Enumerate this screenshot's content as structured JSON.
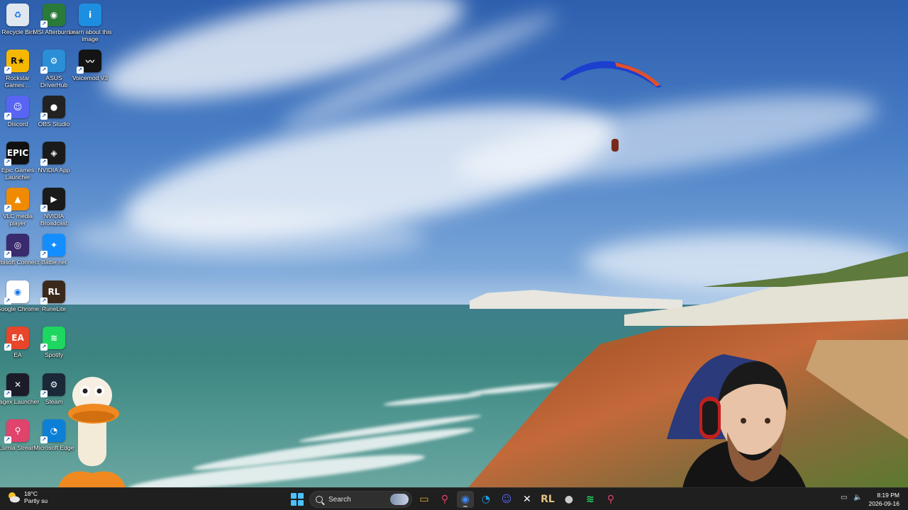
{
  "desktop": {
    "icons": [
      {
        "label": "Recycle Bin",
        "icon": "recycle-bin-icon",
        "color": "#dfe7ef"
      },
      {
        "label": "MSI Afterburner",
        "icon": "msi-afterburner-icon",
        "color": "#2a7a3a"
      },
      {
        "label": "Learn about this image",
        "icon": "info-icon",
        "color": "#1e8fe0"
      },
      {
        "label": "Rockstar Games ...",
        "icon": "rockstar-icon",
        "color": "#f5b800"
      },
      {
        "label": "ASUS DriverHub",
        "icon": "asus-driverhub-icon",
        "color": "#2a8fd6"
      },
      {
        "label": "Voicemod V3",
        "icon": "voicemod-icon",
        "color": "#141414"
      },
      {
        "label": "Discord",
        "icon": "discord-icon",
        "color": "#5865f2"
      },
      {
        "label": "OBS Studio",
        "icon": "obs-icon",
        "color": "#222222"
      },
      {
        "label": "Epic Games Launcher",
        "icon": "epic-games-icon",
        "color": "#111111"
      },
      {
        "label": "NVIDIA App",
        "icon": "nvidia-icon",
        "color": "#1a1a1a"
      },
      {
        "label": "VLC media player",
        "icon": "vlc-icon",
        "color": "#f08a00"
      },
      {
        "label": "NVIDIA Broadcast",
        "icon": "nvidia-broadcast-icon",
        "color": "#1a1a1a"
      },
      {
        "label": "Ubisoft Connect",
        "icon": "ubisoft-icon",
        "color": "#3a2a6e"
      },
      {
        "label": "Battle.net",
        "icon": "battlenet-icon",
        "color": "#148eff"
      },
      {
        "label": "Google Chrome",
        "icon": "chrome-icon",
        "color": "#ffffff"
      },
      {
        "label": "RuneLite",
        "icon": "runelite-icon",
        "color": "#3b2a1c"
      },
      {
        "label": "EA",
        "icon": "ea-icon",
        "color": "#e8452a"
      },
      {
        "label": "Spotify",
        "icon": "spotify-icon",
        "color": "#1ed760"
      },
      {
        "label": "Jagex Launcher",
        "icon": "jagex-icon",
        "color": "#1b1b2a"
      },
      {
        "label": "Steam",
        "icon": "steam-icon",
        "color": "#1b2838"
      },
      {
        "label": "Lumia Stream",
        "icon": "lumia-stream-icon",
        "color": "#e0436b"
      },
      {
        "label": "Microsoft Edge",
        "icon": "edge-icon",
        "color": "#0c7fd6"
      }
    ]
  },
  "taskbar": {
    "weather": {
      "temp": "18°C",
      "desc": "Partly su"
    },
    "search": {
      "label": "Search"
    },
    "apps": [
      {
        "name": "file-explorer",
        "icon": "file-explorer-icon",
        "active": false
      },
      {
        "name": "lumia-stream",
        "icon": "lumia-stream-icon",
        "active": false
      },
      {
        "name": "chrome",
        "icon": "chrome-icon",
        "active": true
      },
      {
        "name": "edge",
        "icon": "edge-icon",
        "active": false
      },
      {
        "name": "discord",
        "icon": "discord-icon",
        "active": false
      },
      {
        "name": "jagex-launcher",
        "icon": "jagex-icon",
        "active": false
      },
      {
        "name": "runelite",
        "icon": "runelite-icon",
        "active": false
      },
      {
        "name": "obs-studio",
        "icon": "obs-icon",
        "active": false
      },
      {
        "name": "spotify",
        "icon": "spotify-icon",
        "active": false
      },
      {
        "name": "lumia-stream-2",
        "icon": "lumia-stream-icon",
        "active": false
      }
    ],
    "clock": {
      "time": "8:19 PM",
      "date": "2026-09-16"
    }
  }
}
